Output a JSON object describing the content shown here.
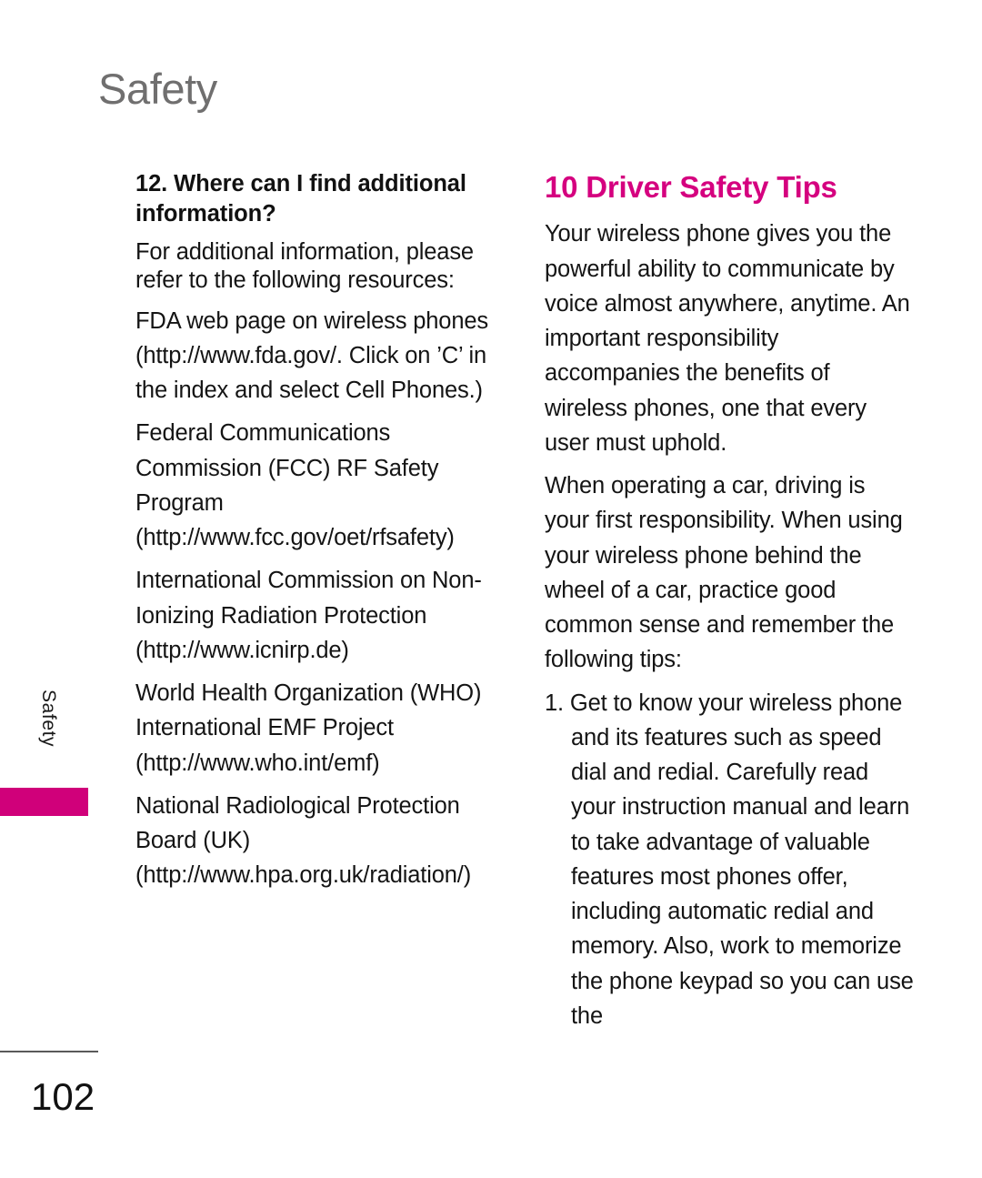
{
  "document": {
    "chapter_title": "Safety",
    "page_number": "102",
    "side_tab_label": "Safety",
    "accent_color": "#d5007f",
    "tab_color": "#d0007a",
    "header_color": "#706f6f"
  },
  "left_column": {
    "heading": "12. Where can I find additional information?",
    "paragraphs": [
      "For additional information, please refer to the following resources:",
      "FDA web page on wireless phones (http://www.fda.gov/. Click on ’C’ in the index and select Cell Phones.)",
      "Federal Communications Commission (FCC) RF Safety Program (http://www.fcc.gov/oet/rfsafety)",
      "International Commission on Non-Ionizing Radiation Protection (http://www.icnirp.de)",
      "World Health Organization (WHO) International EMF Project (http://www.who.int/emf)",
      "National Radiological Protection Board (UK) (http://www.hpa.org.uk/radiation/)"
    ]
  },
  "right_column": {
    "title": "10 Driver Safety Tips",
    "paragraphs": [
      "Your wireless phone gives you the powerful ability to communicate by voice almost anywhere, anytime. An important responsibility accompanies the benefits of wireless phones, one that every user must uphold.",
      "When operating a car, driving is your first responsibility. When using your wireless phone behind the wheel of a car, practice good common sense and remember the following tips:"
    ],
    "list_items": [
      "1. Get to know your wireless phone and its features such as speed dial and redial. Carefully read your instruction manual and learn to take advantage of valuable features most phones offer, including automatic redial and memory. Also, work to memorize the phone keypad so you can use the"
    ]
  }
}
